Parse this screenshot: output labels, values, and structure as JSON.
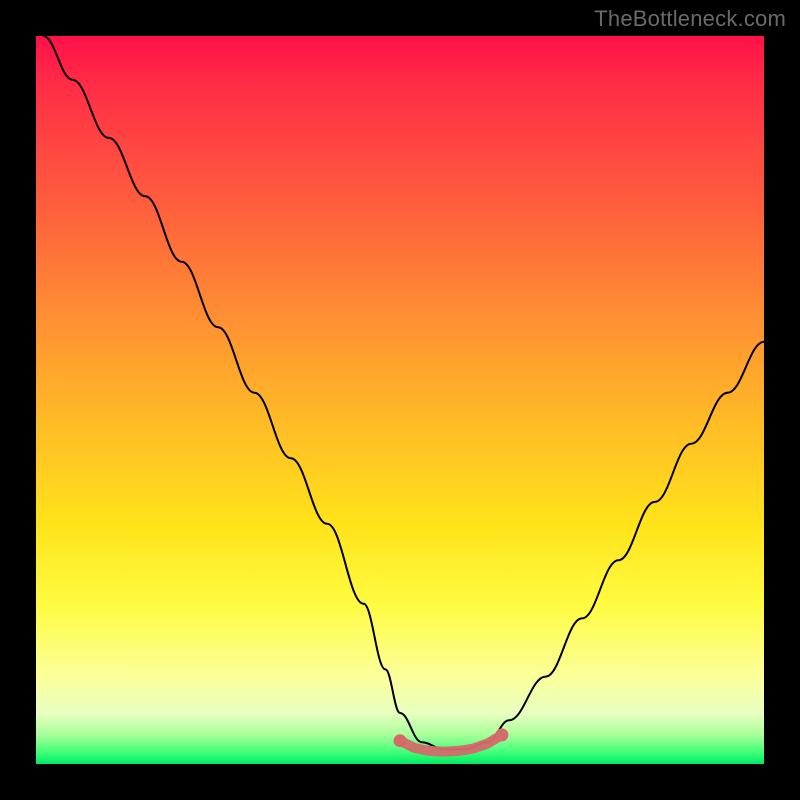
{
  "watermark": "TheBottleneck.com",
  "chart_data": {
    "type": "line",
    "title": "",
    "xlabel": "",
    "ylabel": "",
    "xlim": [
      0,
      100
    ],
    "ylim": [
      0,
      100
    ],
    "grid": false,
    "legend": "none",
    "background_gradient": {
      "orientation": "vertical",
      "stops": [
        {
          "pos": 0.0,
          "color": "#ff1048"
        },
        {
          "pos": 0.22,
          "color": "#ff5a3e"
        },
        {
          "pos": 0.52,
          "color": "#ffb827"
        },
        {
          "pos": 0.78,
          "color": "#fffb40"
        },
        {
          "pos": 0.93,
          "color": "#e8ffc0"
        },
        {
          "pos": 1.0,
          "color": "#00e866"
        }
      ]
    },
    "series": [
      {
        "name": "bottleneck-curve",
        "color": "#000000",
        "x": [
          1,
          5,
          10,
          15,
          20,
          25,
          30,
          35,
          40,
          45,
          48,
          50,
          53,
          56,
          59,
          62,
          65,
          70,
          75,
          80,
          85,
          90,
          95,
          100
        ],
        "y": [
          100,
          94,
          86,
          78,
          69,
          60,
          51,
          42,
          33,
          22,
          13,
          7,
          3,
          2,
          2,
          3,
          6,
          12,
          20,
          28,
          36,
          44,
          51,
          58
        ]
      },
      {
        "name": "optimal-range-marker",
        "color": "#d46a6a",
        "type": "scatter",
        "x": [
          50,
          52,
          54,
          56,
          58,
          60,
          62,
          64
        ],
        "y": [
          3.2,
          2.2,
          1.8,
          1.7,
          1.8,
          2.1,
          2.8,
          4.0
        ]
      }
    ],
    "annotations": []
  }
}
